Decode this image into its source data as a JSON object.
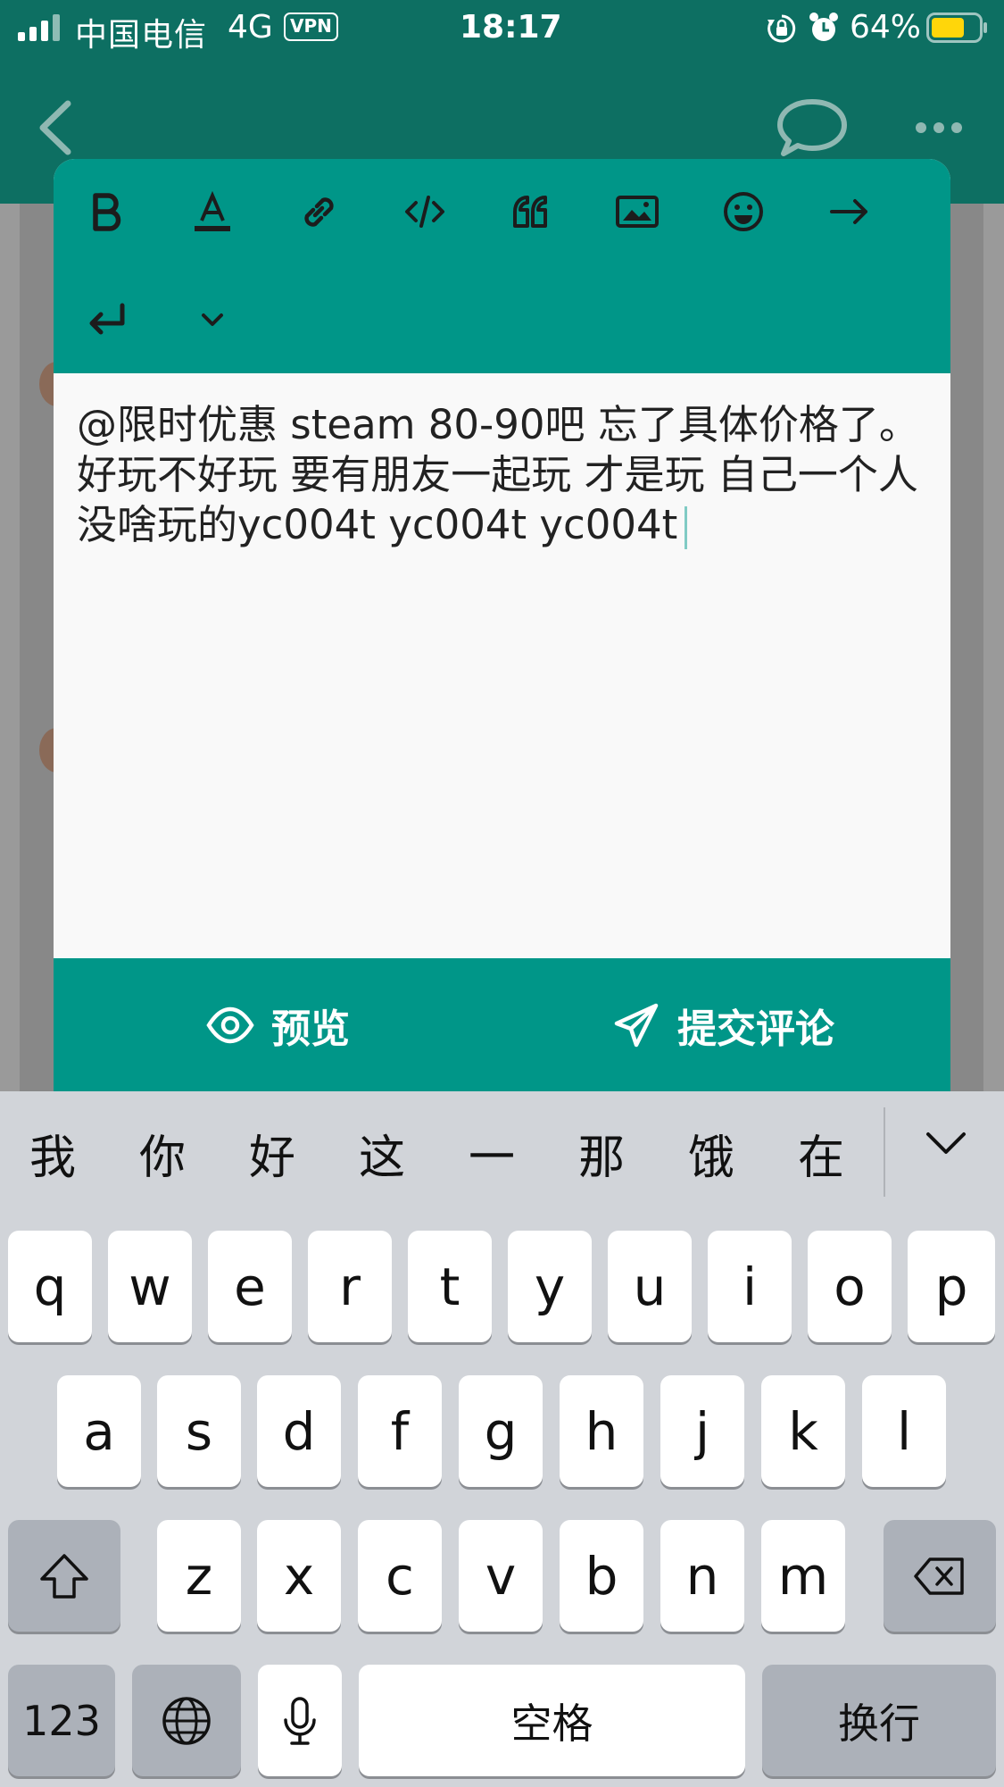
{
  "status_bar": {
    "carrier": "中国电信",
    "network": "4G",
    "vpn": "VPN",
    "time": "18:17",
    "battery": "64%",
    "icons": [
      "signal-icon",
      "rotation-lock-icon",
      "alarm-icon",
      "battery-icon"
    ]
  },
  "header": {
    "icons": [
      "chevron-left-icon",
      "chat-bubble-icon",
      "more-horizontal-icon"
    ]
  },
  "toolbar": {
    "buttons": [
      "bold-icon",
      "text-color-icon",
      "link-icon",
      "code-icon",
      "quote-icon",
      "image-icon",
      "emoji-icon",
      "arrow-right-icon",
      "enter-icon",
      "chevron-down-icon"
    ]
  },
  "editor": {
    "text": "@限时优惠 steam 80-90吧 忘了具体价格了。\n好玩不好玩 要有朋友一起玩 才是玩 自己一个人 没啥玩的yc004t yc004t yc004t"
  },
  "actions": {
    "preview_label": "预览",
    "submit_label": "提交评论",
    "icons": [
      "eye-icon",
      "send-icon"
    ]
  },
  "keyboard": {
    "candidates": [
      "我",
      "你",
      "好",
      "这",
      "一",
      "那",
      "饿",
      "在"
    ],
    "row1": [
      "q",
      "w",
      "e",
      "r",
      "t",
      "y",
      "u",
      "i",
      "o",
      "p"
    ],
    "row2": [
      "a",
      "s",
      "d",
      "f",
      "g",
      "h",
      "j",
      "k",
      "l"
    ],
    "row3": [
      "z",
      "x",
      "c",
      "v",
      "b",
      "n",
      "m"
    ],
    "numbers_label": "123",
    "space_label": "空格",
    "return_label": "换行",
    "icons": [
      "shift-icon",
      "backspace-icon",
      "globe-icon",
      "microphone-icon",
      "chevron-down-icon"
    ]
  },
  "colors": {
    "header": "#0d6f62",
    "accent": "#009688",
    "keyboard_bg": "#d1d4d9"
  }
}
